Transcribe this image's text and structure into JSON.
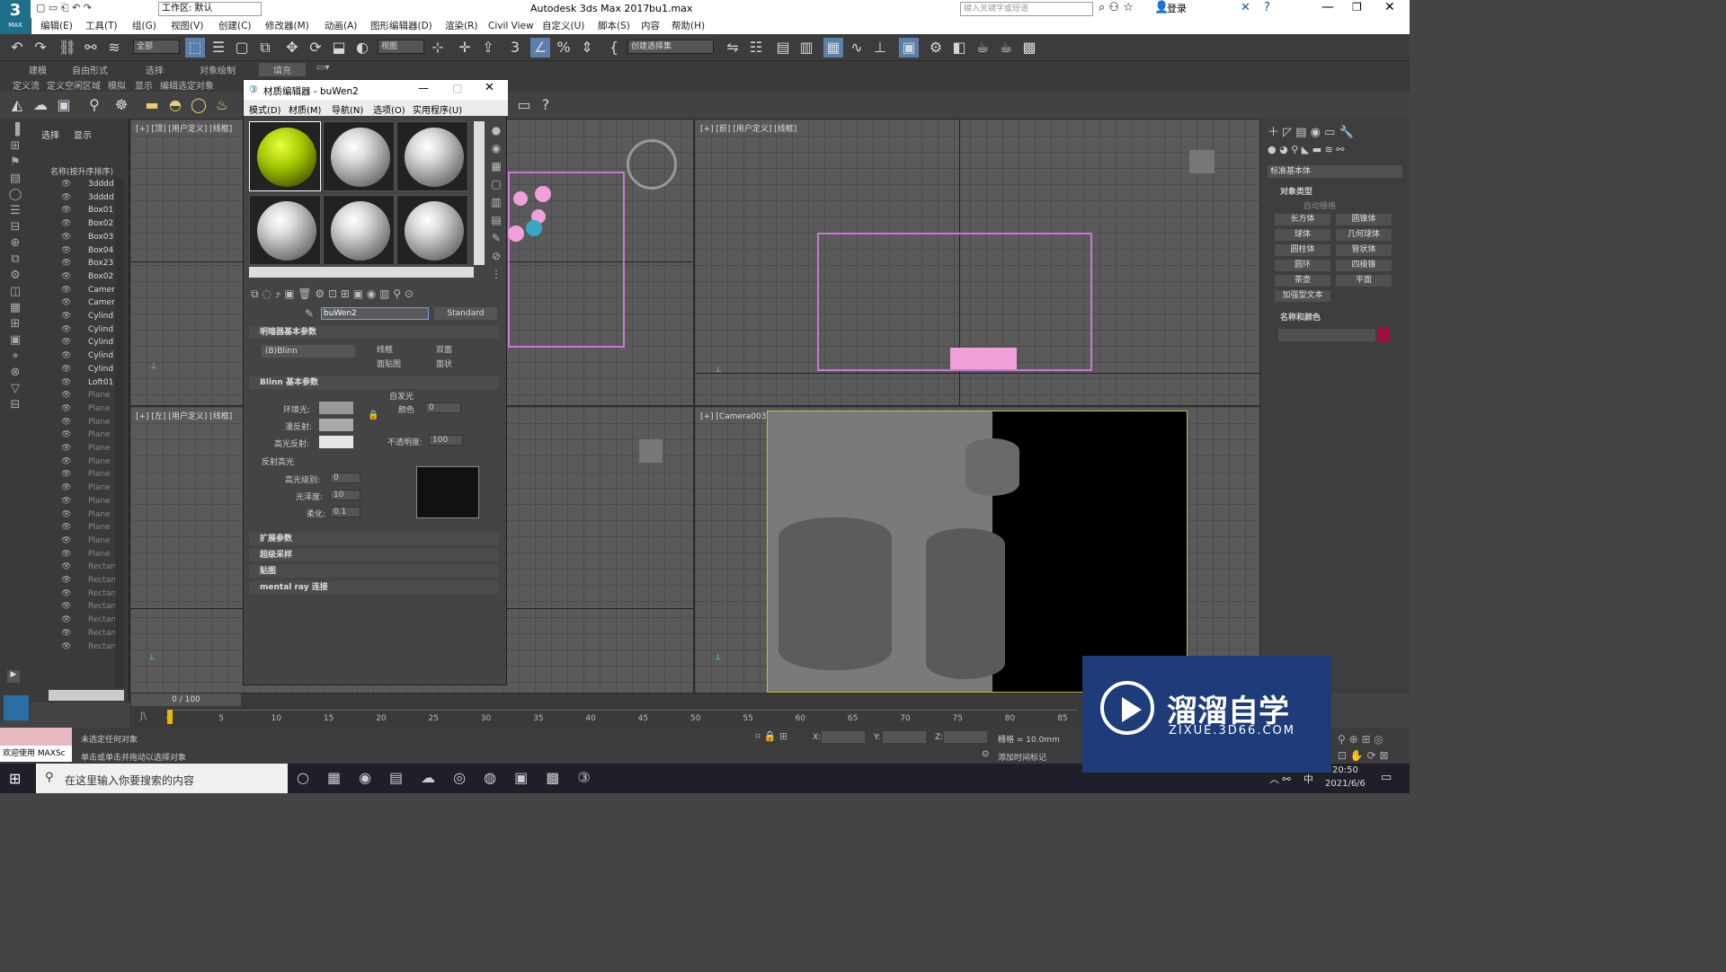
{
  "titlebar": {
    "workspace": "工作区: 默认",
    "app_title": "Autodesk 3ds Max 2017",
    "file": "bu1.max",
    "search_placeholder": "键入关键字或短语",
    "login": "登录"
  },
  "menu": [
    "编辑(E)",
    "工具(T)",
    "组(G)",
    "视图(V)",
    "创建(C)",
    "修改器(M)",
    "动画(A)",
    "图形编辑器(D)",
    "渲染(R)",
    "Civil View",
    "自定义(U)",
    "脚本(S)",
    "内容",
    "帮助(H)"
  ],
  "toolbar": {
    "filter": "全部",
    "refcoord": "视图",
    "selset": "创建选择集"
  },
  "ribbon": {
    "tabs": [
      "建模",
      "自由形式",
      "选择",
      "对象绘制",
      "填充"
    ],
    "sub": [
      "定义流",
      "定义空闲区域",
      "模拟",
      "显示",
      "编辑选定对象"
    ]
  },
  "scene": {
    "tabs": [
      "选择",
      "显示"
    ],
    "header": "名称(按升序排序)",
    "items": [
      "3dddd",
      "3dddd",
      "Box01",
      "Box02",
      "Box03",
      "Box04",
      "Box23",
      "Box02",
      "Camera",
      "Camera",
      "Cylind",
      "Cylind",
      "Cylind",
      "Cylind",
      "Cylind",
      "Loft01",
      "Plane",
      "Plane",
      "Plane",
      "Plane",
      "Plane",
      "Plane",
      "Plane",
      "Plane",
      "Plane",
      "Plane",
      "Plane",
      "Plane",
      "Plane",
      "Rectan",
      "Rectan",
      "Rectan",
      "Rectan",
      "Rectan",
      "Rectan",
      "Rectan"
    ]
  },
  "viewports": {
    "top": "[+] [顶] [用户定义] [线框]",
    "front": "[+] [前] [用户定义] [线框]",
    "left": "[+] [左] [用户定义] [线框]",
    "camera": "[+] [Camera003] [用户定义] [默认明暗处理]"
  },
  "mat": {
    "title": "材质编辑器 - buWen2",
    "menu": [
      "模式(D)",
      "材质(M)",
      "导航(N)",
      "选项(O)",
      "实用程序(U)"
    ],
    "name": "buWen2",
    "type": "Standard",
    "shader_rollout": "明暗器基本参数",
    "shader": "(B)Blinn",
    "wire": "线框",
    "twosided": "双面",
    "facemap": "面贴图",
    "faceted": "面状",
    "blinn_rollout": "Blinn 基本参数",
    "selfillum": "自发光",
    "color": "颜色",
    "selfillum_val": "0",
    "ambient": "环境光:",
    "diffuse": "漫反射:",
    "specular": "高光反射:",
    "opacity": "不透明度:",
    "opacity_val": "100",
    "spec_hl": "反射高光",
    "spec_level": "高光级别:",
    "spec_level_val": "0",
    "gloss": "光泽度:",
    "gloss_val": "10",
    "soften": "柔化:",
    "soften_val": "0.1",
    "rollouts": [
      "扩展参数",
      "超级采样",
      "贴图",
      "mental ray 连接"
    ]
  },
  "cmd": {
    "dropdown": "标准基本体",
    "objtype": "对象类型",
    "autogrid": "自动栅格",
    "buttons": [
      "长方体",
      "圆锥体",
      "球体",
      "几何球体",
      "圆柱体",
      "管状体",
      "圆环",
      "四棱锥",
      "茶壶",
      "平面",
      "加强型文本"
    ],
    "namecolor": "名称和颜色",
    "swatch": "#a0103a"
  },
  "timeline": {
    "frame": "0 / 100",
    "ticks": [
      "0",
      "5",
      "10",
      "15",
      "20",
      "25",
      "30",
      "35",
      "40",
      "45",
      "50",
      "55",
      "60",
      "65",
      "70",
      "75",
      "80",
      "85"
    ]
  },
  "status": {
    "welcome": "欢迎使用 MAXSc",
    "line1": "未选定任何对象",
    "line2": "单击或单击并拖动以选择对象",
    "x": "X:",
    "y": "Y:",
    "z": "Z:",
    "grid": "栅格 = 10.0mm",
    "addtime": "添加时间标记"
  },
  "taskbar": {
    "search": "在这里输入你要搜索的内容",
    "time": "20:50",
    "date": "2021/6/6",
    "ime": "中"
  },
  "watermark": {
    "brand": "溜溜自学",
    "url": "ZIXUE.3D66.COM"
  }
}
